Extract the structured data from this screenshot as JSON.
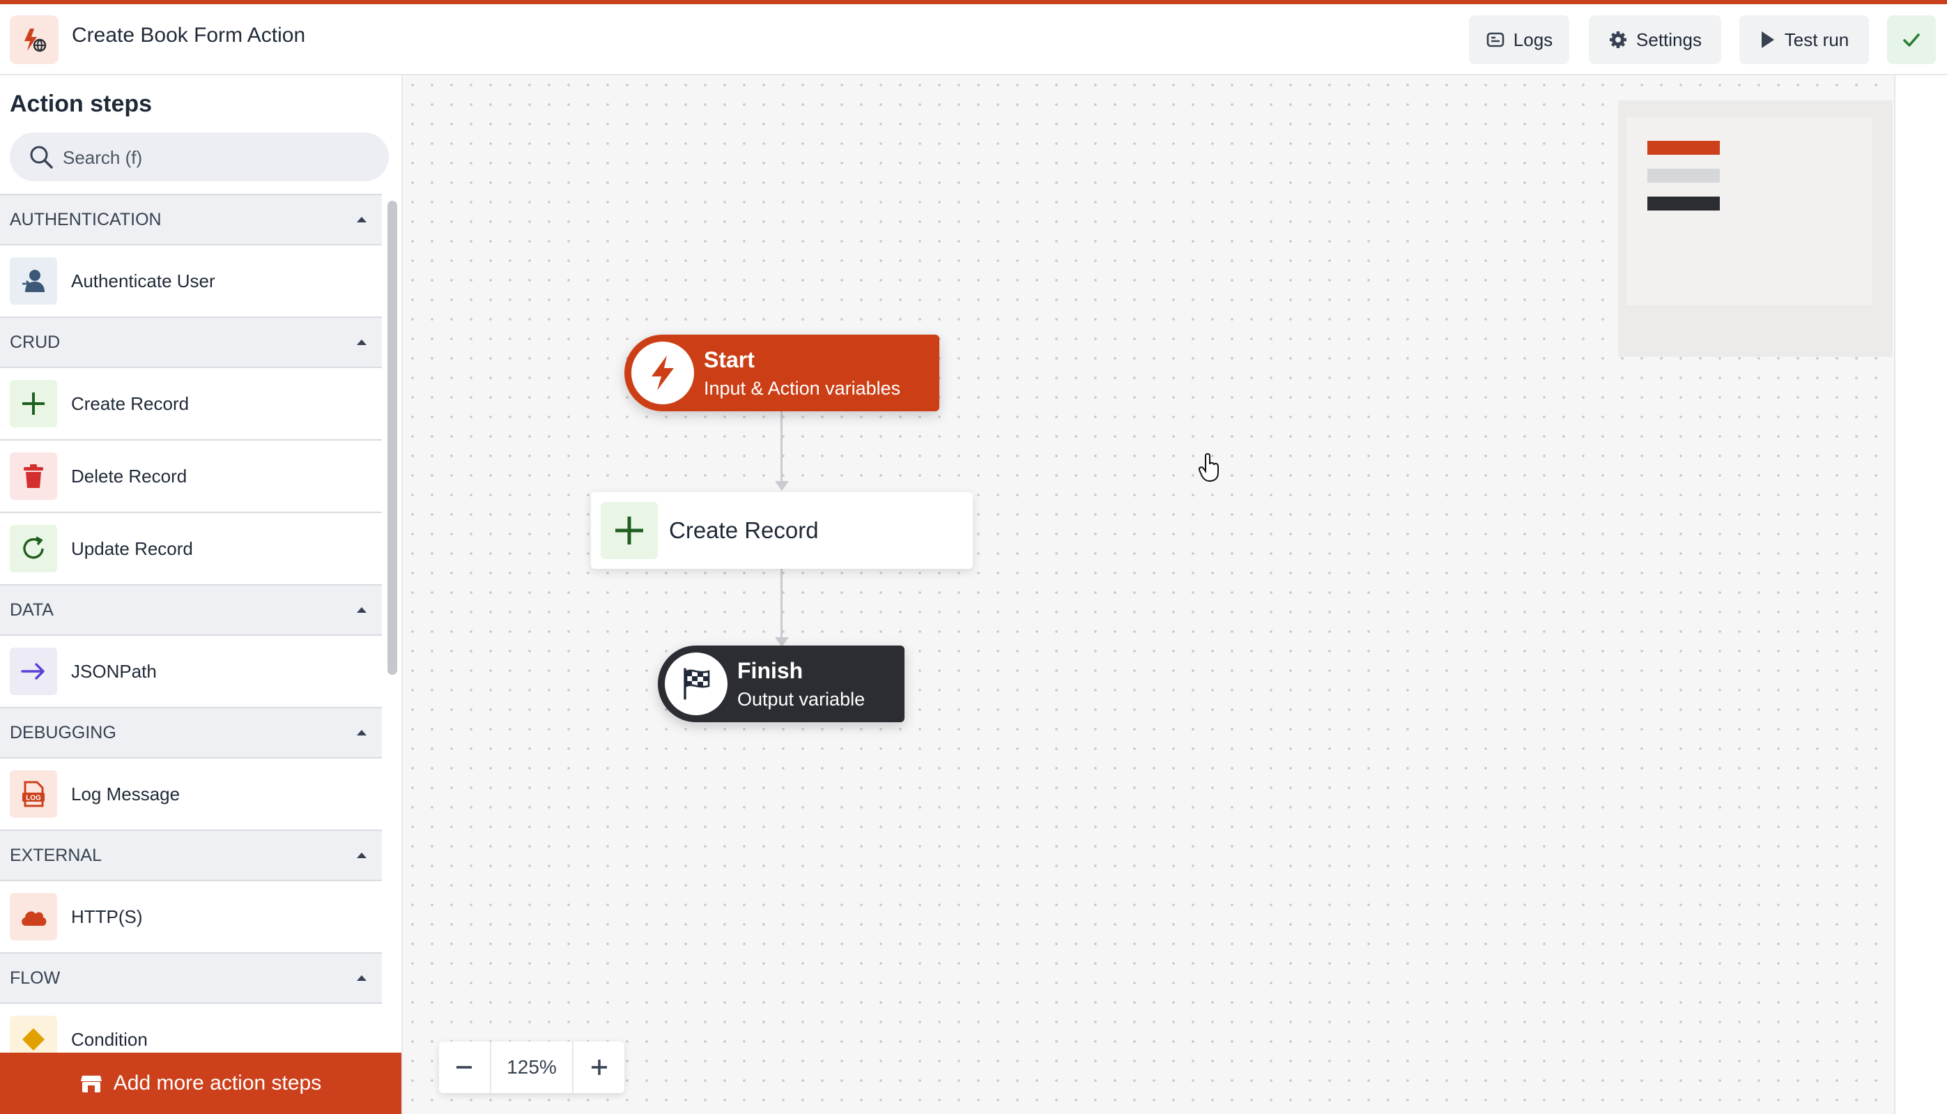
{
  "header": {
    "title": "Create Book Form Action",
    "logs_label": "Logs",
    "settings_label": "Settings",
    "test_run_label": "Test run"
  },
  "sidebar": {
    "title": "Action steps",
    "search_placeholder": "Search (f)",
    "categories": [
      {
        "name": "AUTHENTICATION",
        "items": [
          {
            "label": "Authenticate User",
            "icon": "user-icon"
          }
        ]
      },
      {
        "name": "CRUD",
        "items": [
          {
            "label": "Create Record",
            "icon": "plus-icon"
          },
          {
            "label": "Delete Record",
            "icon": "trash-icon"
          },
          {
            "label": "Update Record",
            "icon": "refresh-icon"
          }
        ]
      },
      {
        "name": "DATA",
        "items": [
          {
            "label": "JSONPath",
            "icon": "arrow-right-icon"
          }
        ]
      },
      {
        "name": "DEBUGGING",
        "items": [
          {
            "label": "Log Message",
            "icon": "log-icon"
          }
        ]
      },
      {
        "name": "EXTERNAL",
        "items": [
          {
            "label": "HTTP(S)",
            "icon": "cloud-icon"
          }
        ]
      },
      {
        "name": "FLOW",
        "items": [
          {
            "label": "Condition",
            "icon": "condition-icon"
          }
        ]
      }
    ],
    "add_more_label": "Add more action steps"
  },
  "canvas": {
    "start_node": {
      "title": "Start",
      "subtitle": "Input & Action variables"
    },
    "create_node": {
      "label": "Create Record"
    },
    "finish_node": {
      "title": "Finish",
      "subtitle": "Output variable"
    },
    "zoom_level": "125%"
  },
  "colors": {
    "accent": "#cc401c",
    "dark": "#2b2d33",
    "success": "#2e7d32"
  }
}
